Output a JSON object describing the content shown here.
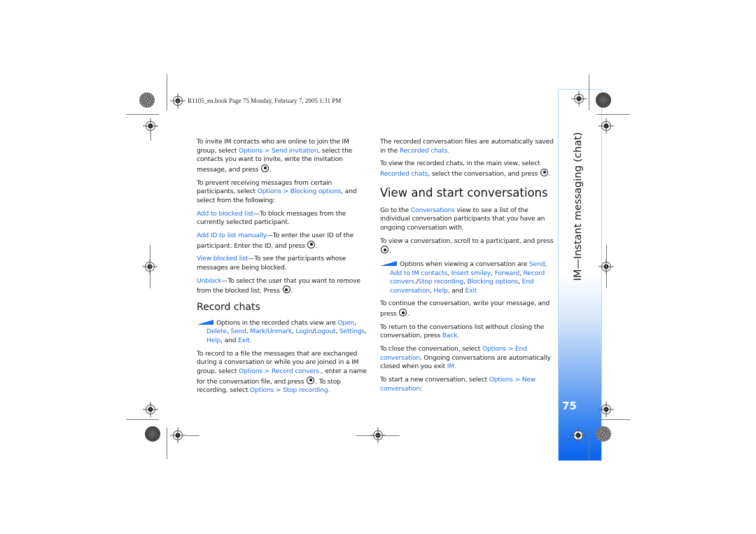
{
  "header": {
    "print_line": "R1105_en.book  Page 75  Monday, February 7, 2005  1:31 PM"
  },
  "left_column": {
    "p1": {
      "t1": "To invite IM contacts who are online to join the IM group, select ",
      "l1": "Options > Send invitation",
      "t2": ", select the contacts you want to invite, write the invitation message, and press ",
      "t3": "."
    },
    "p2": {
      "t1": "To prevent receiving messages from certain participants, select ",
      "l1": "Options > Blocking options",
      "t2": ", and select from the following:"
    },
    "blocking_options": [
      {
        "label": "Add to blocked list",
        "desc": "—To block messages from the currently selected participant."
      },
      {
        "label": "Add ID to list manually",
        "desc": "—To enter the user ID of the participant. Enter the ID, and press ",
        "end": "."
      },
      {
        "label": "View blocked list",
        "desc": "—To see the participants whose messages are being blocked."
      },
      {
        "label": "Unblock",
        "desc": "—To select the user that you want to remove from the blocked list. Press ",
        "end": "."
      }
    ],
    "record_heading": "Record chats",
    "record_note": {
      "t1": "Options in the recorded chats view are ",
      "items": [
        "Open",
        "Delete",
        "Send",
        "Mark/Unmark",
        "Login",
        "Logout",
        "Settings",
        "Help",
        "Exit"
      ],
      "and": " and ",
      "end": "."
    },
    "record_p": {
      "t1": "To record to a file the messages that are exchanged during a conversation or while you are joined in a IM group, select ",
      "l1": "Options > Record convers.",
      "t2": ", enter a name for the conversation file, and press ",
      "t3": ". To stop recording, select ",
      "l2": "Options > Stop recording",
      "t4": "."
    }
  },
  "right_column": {
    "p1": {
      "t1": "The recorded conversation files are automatically saved in the ",
      "l1": "Recorded chats",
      "t2": "."
    },
    "p2": {
      "t1": "To view the recorded chats, in the main view, select ",
      "l1": "Recorded chats",
      "t2": ", select the conversation, and press ",
      "t3": "."
    },
    "heading": "View and start conversations",
    "p3": {
      "t1": "Go to the ",
      "l1": "Conversations",
      "t2": " view to see a list of the individual conversation participants that you have an ongoing conversation with."
    },
    "p4": {
      "t1": "To view a conversation, scroll to a participant, and press ",
      "t2": "."
    },
    "note": {
      "t1": "Options when viewing a conversation are ",
      "items": [
        "Send",
        "Add to IM contacts",
        "Insert smiley",
        "Forward",
        "Record convers.",
        "Stop recording",
        "Blocking options",
        "End conversation",
        "Help",
        "Exit"
      ],
      "and": " and "
    },
    "p5": {
      "t1": "To continue the conversation, write your message, and press ",
      "t2": "."
    },
    "p6": {
      "t1": "To return to the conversations list without closing the conversation, press ",
      "l1": "Back",
      "t2": "."
    },
    "p7": {
      "t1": "To close the conversation, select ",
      "l1": "Options > End conversation",
      "t2": ". Ongoing conversations are automatically closed when you exit ",
      "l2": "IM",
      "t3": "."
    },
    "p8": {
      "t1": "To start a new conversation, select ",
      "l1": "Options > New conversation",
      "t2": ":"
    }
  },
  "side_tab": {
    "title": "IM—Instant messaging (chat)",
    "page_number": "75"
  },
  "colors": {
    "link": "#1e6fe6",
    "tab_gradient_bottom": "#0a63ee",
    "tab_border": "#b9d4f5"
  }
}
